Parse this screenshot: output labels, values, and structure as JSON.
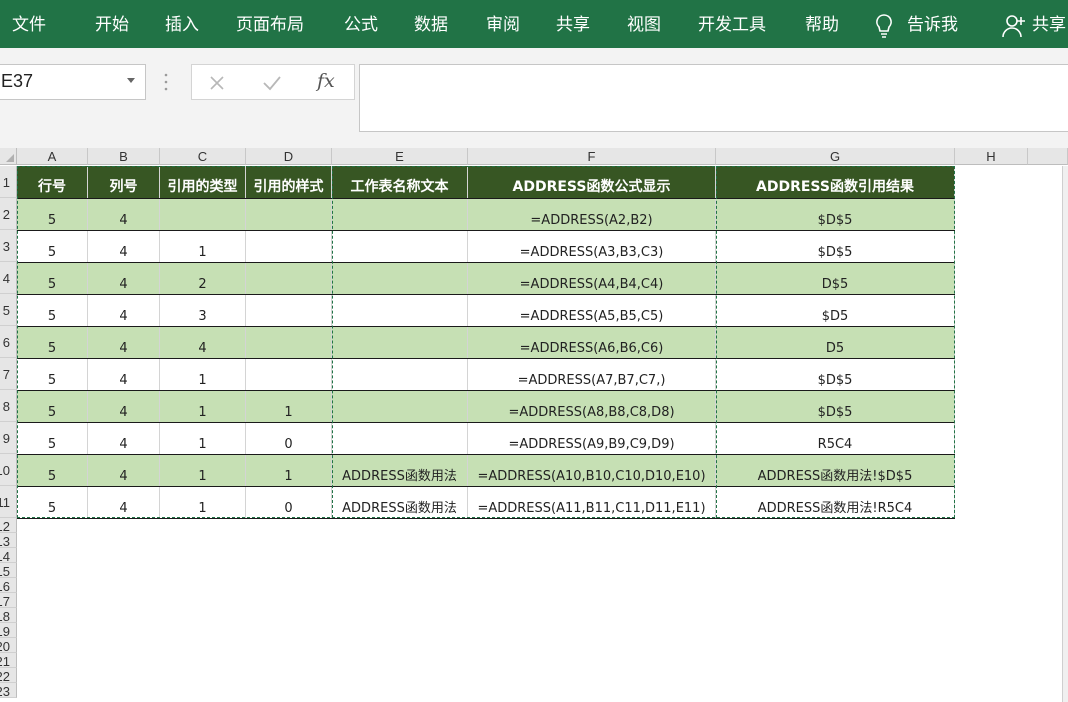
{
  "ribbon": {
    "tabs": [
      "文件",
      "开始",
      "插入",
      "页面布局",
      "公式",
      "数据",
      "审阅",
      "共享",
      "视图",
      "开发工具",
      "帮助"
    ],
    "tell_me": "告诉我",
    "share": "共享",
    "bg_color": "#217346"
  },
  "formula_bar": {
    "name_box": "E37",
    "fx_label": "fx",
    "formula": ""
  },
  "grid": {
    "columns": [
      "A",
      "B",
      "C",
      "D",
      "E",
      "F",
      "G",
      "H"
    ],
    "row_numbers": [
      "1",
      "2",
      "3",
      "4",
      "5",
      "6",
      "7",
      "8",
      "9",
      "10",
      "11",
      "12",
      "13",
      "14",
      "15",
      "16",
      "17",
      "18",
      "19",
      "20",
      "21",
      "22",
      "23"
    ],
    "header": [
      "行号",
      "列号",
      "引用的类型",
      "引用的样式",
      "工作表名称文本",
      "ADDRESS函数公式显示",
      "ADDRESS函数引用结果"
    ],
    "rows": [
      [
        "5",
        "4",
        "",
        "",
        "",
        "=ADDRESS(A2,B2)",
        "$D$5"
      ],
      [
        "5",
        "4",
        "1",
        "",
        "",
        "=ADDRESS(A3,B3,C3)",
        "$D$5"
      ],
      [
        "5",
        "4",
        "2",
        "",
        "",
        "=ADDRESS(A4,B4,C4)",
        "D$5"
      ],
      [
        "5",
        "4",
        "3",
        "",
        "",
        "=ADDRESS(A5,B5,C5)",
        "$D5"
      ],
      [
        "5",
        "4",
        "4",
        "",
        "",
        "=ADDRESS(A6,B6,C6)",
        "D5"
      ],
      [
        "5",
        "4",
        "1",
        "",
        "",
        "=ADDRESS(A7,B7,C7,)",
        "$D$5"
      ],
      [
        "5",
        "4",
        "1",
        "1",
        "",
        "=ADDRESS(A8,B8,C8,D8)",
        "$D$5"
      ],
      [
        "5",
        "4",
        "1",
        "0",
        "",
        "=ADDRESS(A9,B9,C9,D9)",
        "R5C4"
      ],
      [
        "5",
        "4",
        "1",
        "1",
        "ADDRESS函数用法",
        "=ADDRESS(A10,B10,C10,D10,E10)",
        "ADDRESS函数用法!$D$5"
      ],
      [
        "5",
        "4",
        "1",
        "0",
        "ADDRESS函数用法",
        "=ADDRESS(A11,B11,C11,D11,E11)",
        "ADDRESS函数用法!R5C4"
      ]
    ],
    "colors": {
      "header_fill": "#375623",
      "band_fill": "#c6e0b4",
      "copy_border": "#217346"
    }
  }
}
